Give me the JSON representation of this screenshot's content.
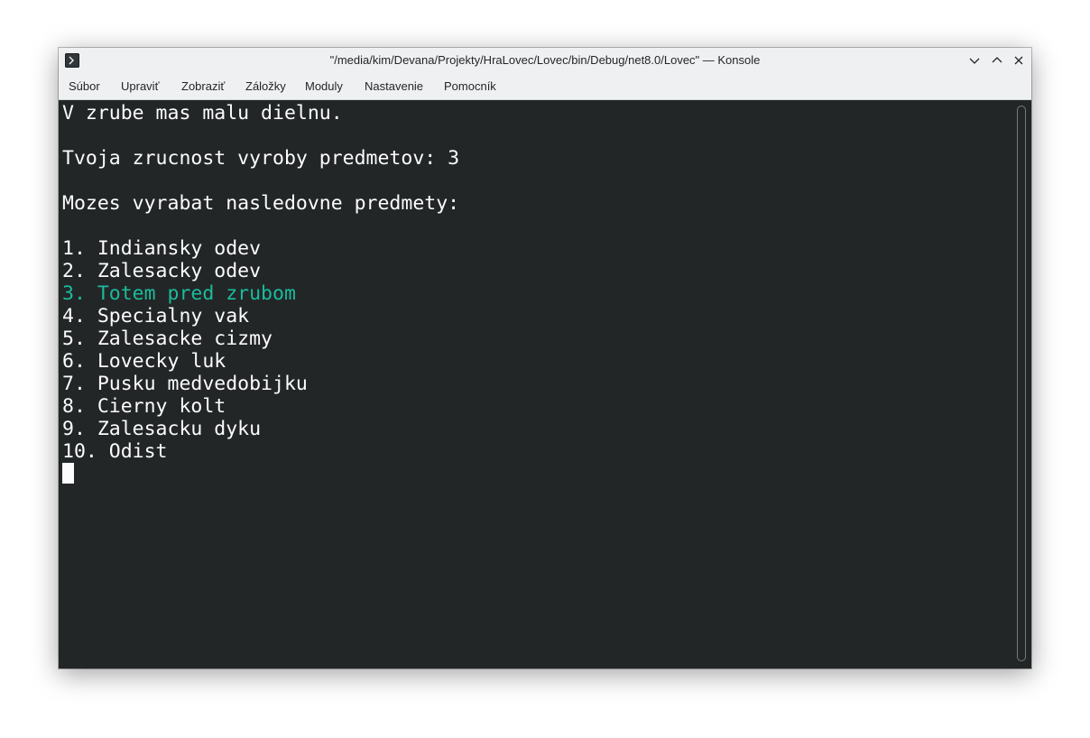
{
  "window": {
    "title": "\"/media/kim/Devana/Projekty/HraLovec/Lovec/bin/Debug/net8.0/Lovec\" — Konsole",
    "app_icon": "terminal-icon",
    "buttons": {
      "minimize": "chevron-down-icon",
      "maximize": "chevron-up-icon",
      "close": "close-icon"
    }
  },
  "menu": {
    "items": [
      {
        "label": "Súbor"
      },
      {
        "label": "Upraviť"
      },
      {
        "label": "Zobraziť"
      },
      {
        "label": "Záložky"
      },
      {
        "label": "Moduly"
      },
      {
        "label": "Nastavenie"
      },
      {
        "label": "Pomocník"
      }
    ]
  },
  "terminal": {
    "lines": [
      "V zrube mas malu dielnu.",
      "Tvoja zrucnost vyroby predmetov: 3",
      "Mozes vyrabat nasledovne predmety:",
      "1. Indiansky odev",
      "2. Zalesacky odev",
      "3. Totem pred zrubom",
      "4. Specialny vak",
      "5. Zalesacke cizmy",
      "6. Lovecky luk",
      "7. Pusku medvedobijku",
      "8. Cierny kolt",
      "9. Zalesacku dyku",
      "10. Odist"
    ],
    "highlight_color": "#1abc9c",
    "text_color": "#fcfcfc",
    "background_color": "#232627"
  }
}
